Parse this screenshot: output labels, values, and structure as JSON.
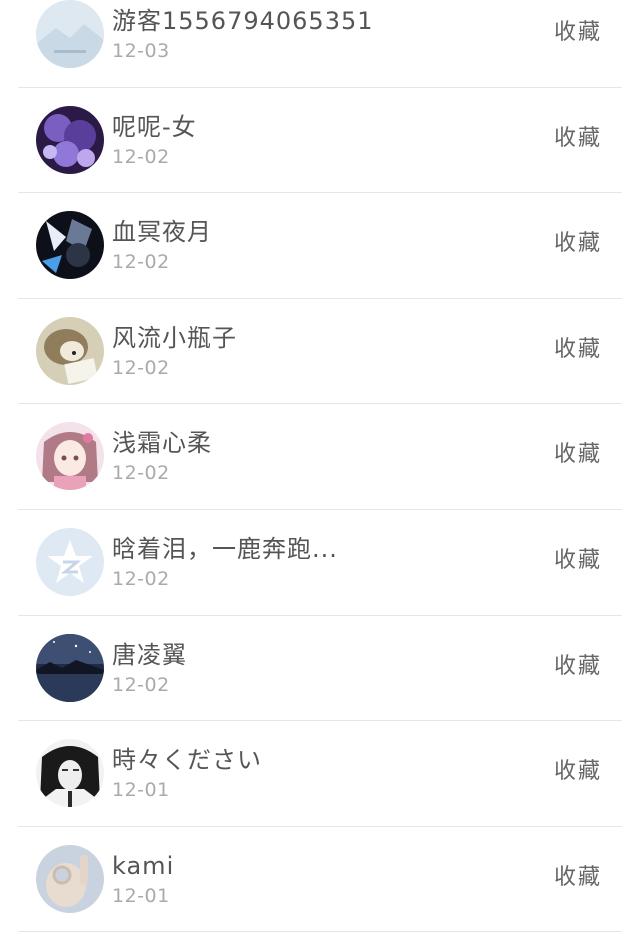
{
  "items": [
    {
      "name": "游客1556794065351",
      "date": "12-03",
      "action": "收藏",
      "avatar": "avatar-landscape-placeholder"
    },
    {
      "name": "呢呢-女",
      "date": "12-02",
      "action": "收藏",
      "avatar": "avatar-purple-flowers"
    },
    {
      "name": "血冥夜月",
      "date": "12-02",
      "action": "收藏",
      "avatar": "avatar-dark-anime-character"
    },
    {
      "name": "风流小瓶子",
      "date": "12-02",
      "action": "收藏",
      "avatar": "avatar-hedgehog"
    },
    {
      "name": "浅霜心柔",
      "date": "12-02",
      "action": "收藏",
      "avatar": "avatar-anime-girl-pink"
    },
    {
      "name": "晗着泪，一鹿奔跑...",
      "date": "12-02",
      "action": "收藏",
      "avatar": "avatar-default-star"
    },
    {
      "name": "唐凌翼",
      "date": "12-02",
      "action": "收藏",
      "avatar": "avatar-night-lake"
    },
    {
      "name": "時々ください",
      "date": "12-01",
      "action": "收藏",
      "avatar": "avatar-bw-portrait"
    },
    {
      "name": "kami",
      "date": "12-01",
      "action": "收藏",
      "avatar": "avatar-hand-gesture"
    }
  ]
}
